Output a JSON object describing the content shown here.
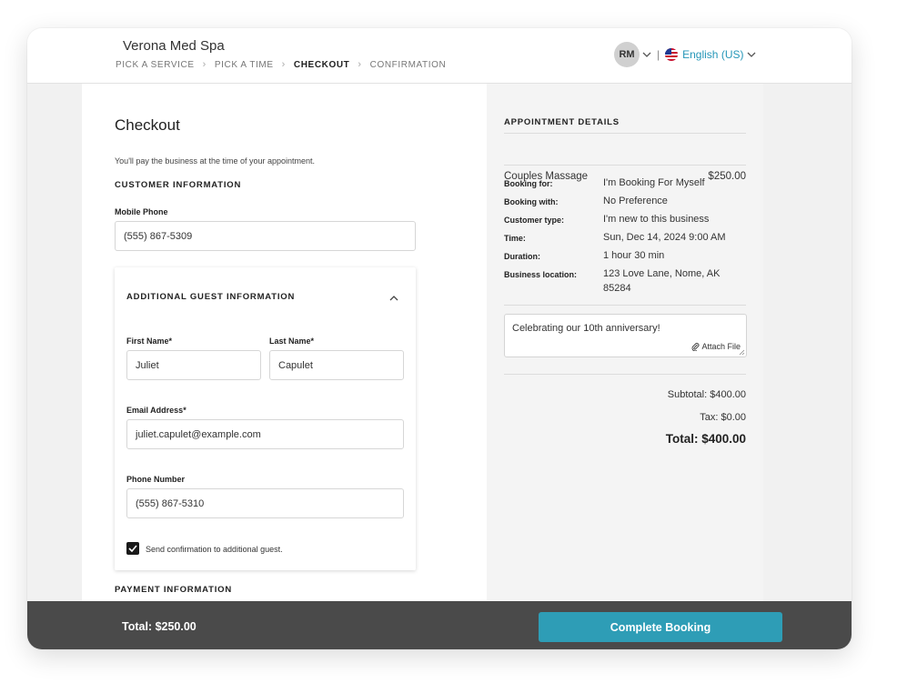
{
  "header": {
    "business_name": "Verona Med Spa",
    "breadcrumbs": [
      {
        "label": "PICK A SERVICE"
      },
      {
        "label": "PICK A TIME"
      },
      {
        "label": "CHECKOUT"
      },
      {
        "label": "CONFIRMATION"
      }
    ],
    "active_step": "CHECKOUT",
    "user_initials": "RM",
    "language": "English (US)"
  },
  "checkout": {
    "title": "Checkout",
    "payment_note": "You'll pay the business at the time of your appointment.",
    "customer_section": "CUSTOMER INFORMATION",
    "mobile_phone_label": "Mobile Phone",
    "mobile_phone_value": "(555) 867-5309",
    "guest": {
      "section_title": "ADDITIONAL GUEST INFORMATION",
      "first_name_label": "First Name*",
      "first_name_value": "Juliet",
      "last_name_label": "Last Name*",
      "last_name_value": "Capulet",
      "email_label": "Email Address*",
      "email_value": "juliet.capulet@example.com",
      "phone_label": "Phone Number",
      "phone_value": "(555) 867-5310",
      "send_confirmation_label": "Send confirmation to additional guest.",
      "send_confirmation_checked": true
    },
    "payment_section": "PAYMENT INFORMATION"
  },
  "appointment": {
    "section_title": "APPOINTMENT DETAILS",
    "service_name": "Couples Massage",
    "service_price": "$250.00",
    "details": [
      {
        "label": "Booking for:",
        "value": "I'm Booking For Myself"
      },
      {
        "label": "Booking with:",
        "value": "No Preference"
      },
      {
        "label": "Customer type:",
        "value": "I'm new to this business"
      },
      {
        "label": "Time:",
        "value": "Sun, Dec 14, 2024 9:00 AM"
      },
      {
        "label": "Duration:",
        "value": "1 hour 30 min"
      },
      {
        "label": "Business location:",
        "value": "123 Love Lane, Nome, AK 85284"
      }
    ],
    "notes_text": "Celebrating our 10th anniversary!",
    "attach_label": "Attach File",
    "subtotal": "Subtotal: $400.00",
    "tax": "Tax: $0.00",
    "total": "Total: $400.00"
  },
  "footer": {
    "total": "Total: $250.00",
    "button_label": "Complete Booking"
  },
  "colors": {
    "accent": "#2e9db6",
    "link": "#2596b8",
    "footer_bg": "#4a4a4a"
  }
}
